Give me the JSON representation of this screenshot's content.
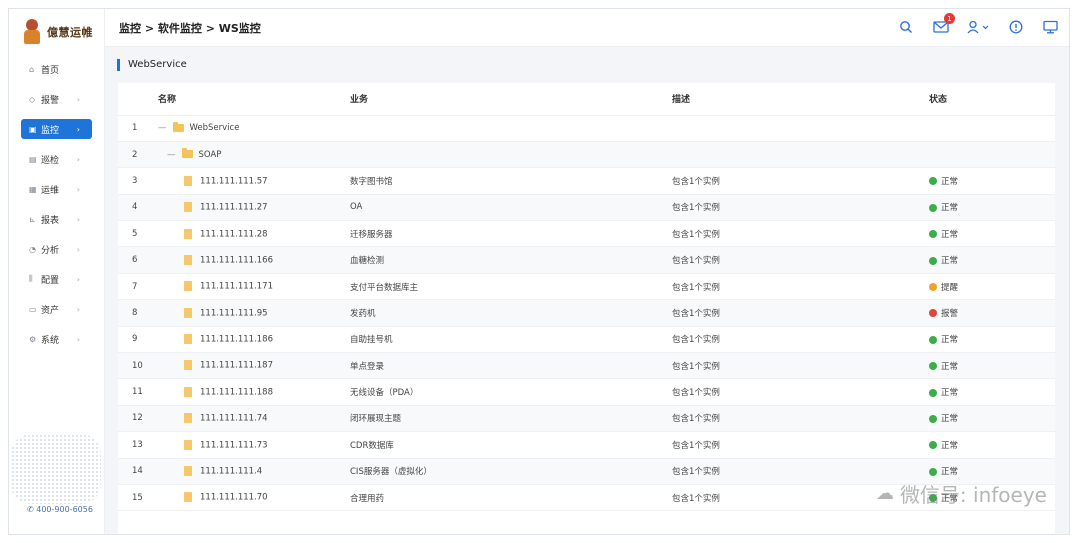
{
  "logo": {
    "text": "億慧运帷"
  },
  "sidebar": {
    "items": [
      {
        "label": "首页",
        "icon": "home-icon",
        "glyph": "⌂",
        "chevron": ""
      },
      {
        "label": "报警",
        "icon": "bell-icon",
        "glyph": "◇",
        "chevron": "›"
      },
      {
        "label": "监控",
        "icon": "monitor-icon",
        "glyph": "▣",
        "chevron": "›"
      },
      {
        "label": "巡检",
        "icon": "clipboard-icon",
        "glyph": "▤",
        "chevron": "›"
      },
      {
        "label": "运维",
        "icon": "tools-icon",
        "glyph": "▦",
        "chevron": "›"
      },
      {
        "label": "报表",
        "icon": "chart-icon",
        "glyph": "⊾",
        "chevron": "›"
      },
      {
        "label": "分析",
        "icon": "pie-icon",
        "glyph": "◔",
        "chevron": "›"
      },
      {
        "label": "配置",
        "icon": "sliders-icon",
        "glyph": "⫼",
        "chevron": "›"
      },
      {
        "label": "资产",
        "icon": "folder-icon",
        "glyph": "▭",
        "chevron": "›"
      },
      {
        "label": "系统",
        "icon": "gear-icon",
        "glyph": "⚙",
        "chevron": "›"
      }
    ],
    "phone": "400-900-6056"
  },
  "header": {
    "breadcrumb": "监控 > 软件监控 > WS监控",
    "mail_badge": "1"
  },
  "section": {
    "title": "WebService"
  },
  "table": {
    "headers": {
      "name": "名称",
      "biz": "业务",
      "desc": "描述",
      "status": "状态"
    },
    "rows": [
      {
        "idx": "1",
        "name": "WebService",
        "kind": "root",
        "biz": "",
        "desc": "",
        "status": "",
        "level": ""
      },
      {
        "idx": "2",
        "name": "SOAP",
        "kind": "group",
        "biz": "",
        "desc": "",
        "status": "",
        "level": ""
      },
      {
        "idx": "3",
        "name": "111.111.111.57",
        "kind": "leaf",
        "biz": "数字图书馆",
        "desc": "包含1个实例",
        "status": "正常",
        "level": "ok"
      },
      {
        "idx": "4",
        "name": "111.111.111.27",
        "kind": "leaf",
        "biz": "OA",
        "desc": "包含1个实例",
        "status": "正常",
        "level": "ok"
      },
      {
        "idx": "5",
        "name": "111.111.111.28",
        "kind": "leaf",
        "biz": "迁移服务器",
        "desc": "包含1个实例",
        "status": "正常",
        "level": "ok"
      },
      {
        "idx": "6",
        "name": "111.111.111.166",
        "kind": "leaf",
        "biz": "血糖检测",
        "desc": "包含1个实例",
        "status": "正常",
        "level": "ok"
      },
      {
        "idx": "7",
        "name": "111.111.111.171",
        "kind": "leaf",
        "biz": "支付平台数据库主",
        "desc": "包含1个实例",
        "status": "提醒",
        "level": "warn"
      },
      {
        "idx": "8",
        "name": "111.111.111.95",
        "kind": "leaf",
        "biz": "发药机",
        "desc": "包含1个实例",
        "status": "报警",
        "level": "alarm"
      },
      {
        "idx": "9",
        "name": "111.111.111.186",
        "kind": "leaf",
        "biz": "自助挂号机",
        "desc": "包含1个实例",
        "status": "正常",
        "level": "ok"
      },
      {
        "idx": "10",
        "name": "111.111.111.187",
        "kind": "leaf",
        "biz": "单点登录",
        "desc": "包含1个实例",
        "status": "正常",
        "level": "ok"
      },
      {
        "idx": "11",
        "name": "111.111.111.188",
        "kind": "leaf",
        "biz": "无线设备（PDA）",
        "desc": "包含1个实例",
        "status": "正常",
        "level": "ok"
      },
      {
        "idx": "12",
        "name": "111.111.111.74",
        "kind": "leaf",
        "biz": "闭环展现主题",
        "desc": "包含1个实例",
        "status": "正常",
        "level": "ok"
      },
      {
        "idx": "13",
        "name": "111.111.111.73",
        "kind": "leaf",
        "biz": "CDR数据库",
        "desc": "包含1个实例",
        "status": "正常",
        "level": "ok"
      },
      {
        "idx": "14",
        "name": "111.111.111.4",
        "kind": "leaf",
        "biz": "CIS服务器（虚拟化）",
        "desc": "包含1个实例",
        "status": "正常",
        "level": "ok"
      },
      {
        "idx": "15",
        "name": "111.111.111.70",
        "kind": "leaf",
        "biz": "合理用药",
        "desc": "包含1个实例",
        "status": "正常",
        "level": "ok"
      }
    ]
  },
  "watermark": "微信号: infoeye",
  "colors": {
    "accent": "#1e74d8",
    "ok": "#3bae4a",
    "warn": "#f0a22b",
    "alarm": "#e0443a"
  }
}
